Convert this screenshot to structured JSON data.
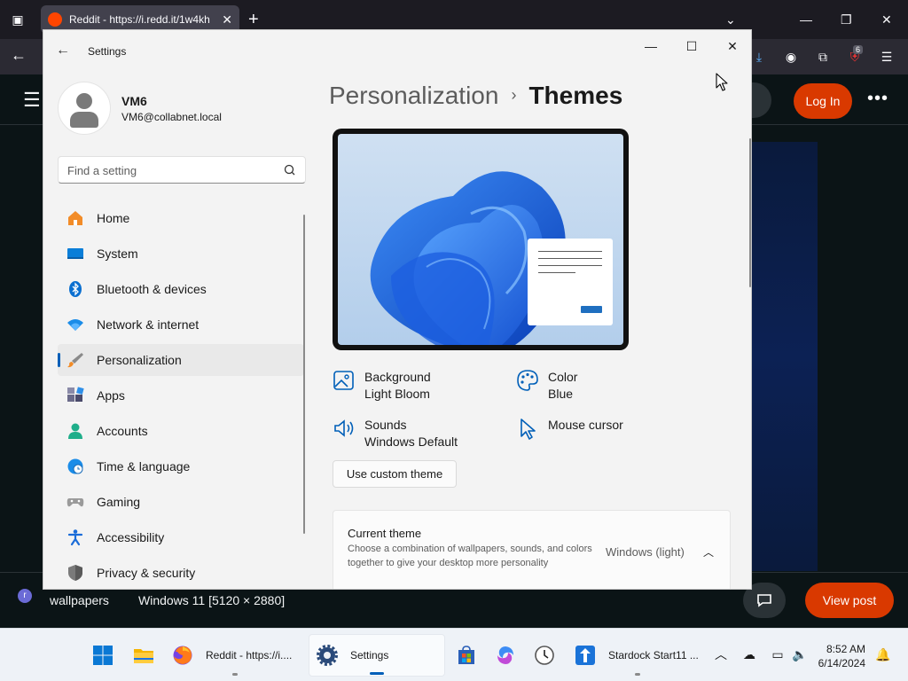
{
  "browser": {
    "tab_title": "Reddit - https://i.redd.it/1w4kh",
    "extension_badge": "6"
  },
  "reddit": {
    "login_label": "Log In",
    "more_label": "•••",
    "subreddit": "wallpapers",
    "post_title": "Windows 11 [5120 × 2880]",
    "view_post_label": "View post"
  },
  "settings": {
    "window_title": "Settings",
    "user": {
      "name": "VM6",
      "email": "VM6@collabnet.local"
    },
    "search": {
      "placeholder": "Find a setting"
    },
    "nav": [
      {
        "label": "Home",
        "icon": "home-icon"
      },
      {
        "label": "System",
        "icon": "system-icon"
      },
      {
        "label": "Bluetooth & devices",
        "icon": "bluetooth-icon"
      },
      {
        "label": "Network & internet",
        "icon": "wifi-icon"
      },
      {
        "label": "Personalization",
        "icon": "brush-icon",
        "active": true
      },
      {
        "label": "Apps",
        "icon": "apps-icon"
      },
      {
        "label": "Accounts",
        "icon": "account-icon"
      },
      {
        "label": "Time & language",
        "icon": "globe-clock-icon"
      },
      {
        "label": "Gaming",
        "icon": "gamepad-icon"
      },
      {
        "label": "Accessibility",
        "icon": "accessibility-icon"
      },
      {
        "label": "Privacy & security",
        "icon": "shield-icon"
      }
    ],
    "breadcrumb": {
      "parent": "Personalization",
      "separator": "›",
      "current": "Themes"
    },
    "theme_props": {
      "background": {
        "title": "Background",
        "value": "Light Bloom"
      },
      "color": {
        "title": "Color",
        "value": "Blue"
      },
      "sounds": {
        "title": "Sounds",
        "value": "Windows Default"
      },
      "cursor": {
        "title": "Mouse cursor"
      }
    },
    "custom_theme_label": "Use custom theme",
    "current_theme": {
      "title": "Current theme",
      "description": "Choose a combination of wallpapers, sounds, and colors together to give your desktop more personality",
      "value": "Windows (light)"
    },
    "accent_color": "#005fb8"
  },
  "taskbar": {
    "apps": [
      {
        "name": "start",
        "label": ""
      },
      {
        "name": "file-explorer",
        "label": ""
      },
      {
        "name": "firefox",
        "label": "Reddit - https://i...."
      },
      {
        "name": "settings",
        "label": "Settings",
        "active": true
      },
      {
        "name": "store",
        "label": ""
      },
      {
        "name": "copilot",
        "label": ""
      },
      {
        "name": "clock-app",
        "label": ""
      },
      {
        "name": "stardock",
        "label": "Stardock Start11 ..."
      }
    ],
    "clock": {
      "time": "8:52 AM",
      "date": "6/14/2024"
    }
  }
}
